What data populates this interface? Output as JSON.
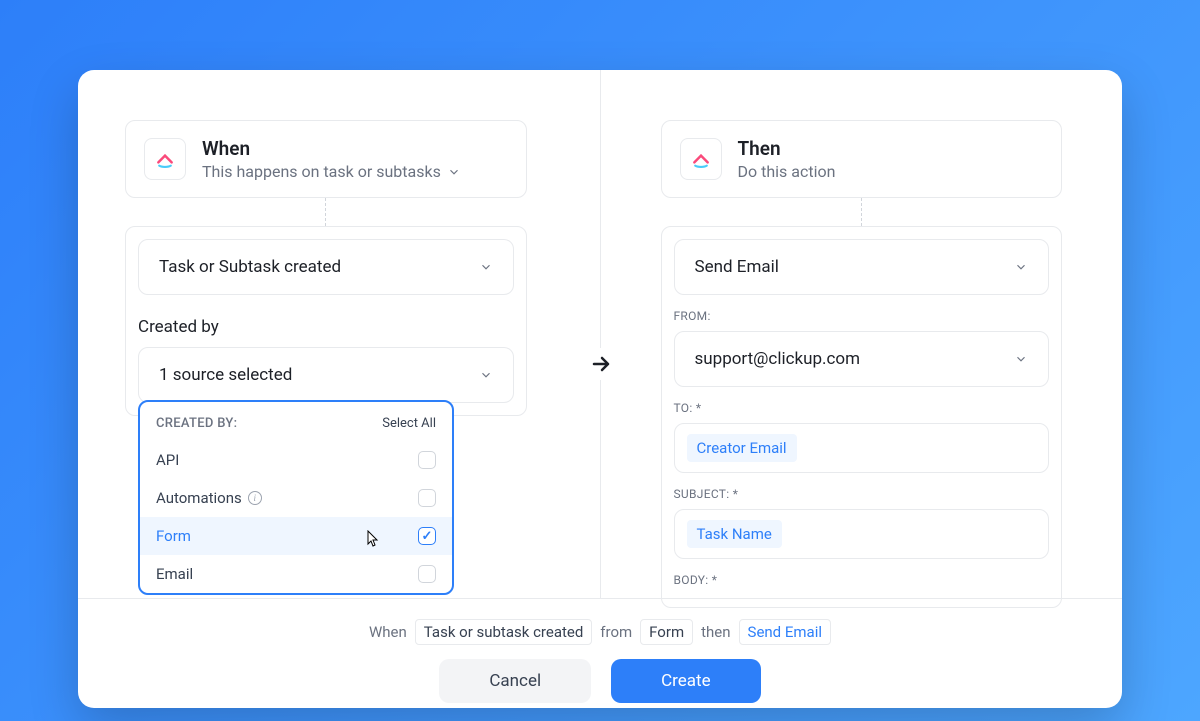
{
  "when": {
    "title": "When",
    "subtitle": "This happens on task or subtasks",
    "trigger_label": "Task or Subtask created",
    "created_by_label": "Created by",
    "source_selected_label": "1 source selected"
  },
  "dropdown": {
    "header": "CREATED BY:",
    "select_all": "Select All",
    "items": [
      {
        "label": "API",
        "checked": false,
        "info": false
      },
      {
        "label": "Automations",
        "checked": false,
        "info": true
      },
      {
        "label": "Form",
        "checked": true,
        "info": false
      },
      {
        "label": "Email",
        "checked": false,
        "info": false
      }
    ]
  },
  "then": {
    "title": "Then",
    "subtitle": "Do this action",
    "action_label": "Send Email",
    "from_label": "FROM:",
    "from_value": "support@clickup.com",
    "to_label": "TO: *",
    "to_chip": "Creator Email",
    "subject_label": "SUBJECT: *",
    "subject_chip": "Task Name",
    "body_label": "BODY: *"
  },
  "summary": {
    "when": "When",
    "trigger": "Task or subtask created",
    "from": "from",
    "source": "Form",
    "then": "then",
    "action": "Send Email"
  },
  "buttons": {
    "cancel": "Cancel",
    "create": "Create"
  }
}
